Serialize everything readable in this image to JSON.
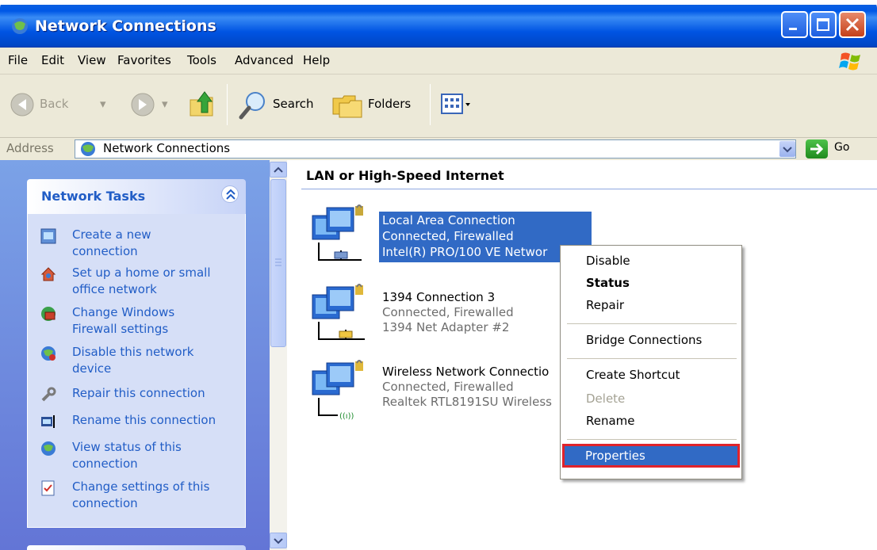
{
  "window": {
    "title": "Network Connections"
  },
  "menu": [
    "File",
    "Edit",
    "View",
    "Favorites",
    "Tools",
    "Advanced",
    "Help"
  ],
  "toolbar": {
    "back": "Back",
    "search": "Search",
    "folders": "Folders"
  },
  "address": {
    "label": "Address",
    "value": "Network Connections",
    "go": "Go"
  },
  "tasks": {
    "heading": "Network Tasks",
    "items": [
      "Create a new\nconnection",
      "Set up a home or small\noffice network",
      "Change Windows\nFirewall settings",
      "Disable this network\ndevice",
      "Repair this connection",
      "Rename this connection",
      "View status of this\nconnection",
      "Change settings of this\nconnection"
    ]
  },
  "group": {
    "heading": "LAN or High-Speed Internet"
  },
  "connections": [
    {
      "name": "Local Area Connection",
      "status": "Connected, Firewalled",
      "device": "Intel(R) PRO/100 VE Networ",
      "selected": true
    },
    {
      "name": "1394 Connection 3",
      "status": "Connected, Firewalled",
      "device": "1394 Net Adapter #2"
    },
    {
      "name": "Wireless Network Connectio",
      "status": "Connected, Firewalled",
      "device": "Realtek RTL8191SU Wireless"
    }
  ],
  "context_menu": {
    "disable": "Disable",
    "status": "Status",
    "repair": "Repair",
    "bridge": "Bridge Connections",
    "shortcut": "Create Shortcut",
    "delete": "Delete",
    "rename": "Rename",
    "properties": "Properties"
  },
  "colors": {
    "title_blue": "#0054e3",
    "task_link": "#215dc6",
    "selection": "#316ac5",
    "highlight_border": "#e0232b"
  }
}
